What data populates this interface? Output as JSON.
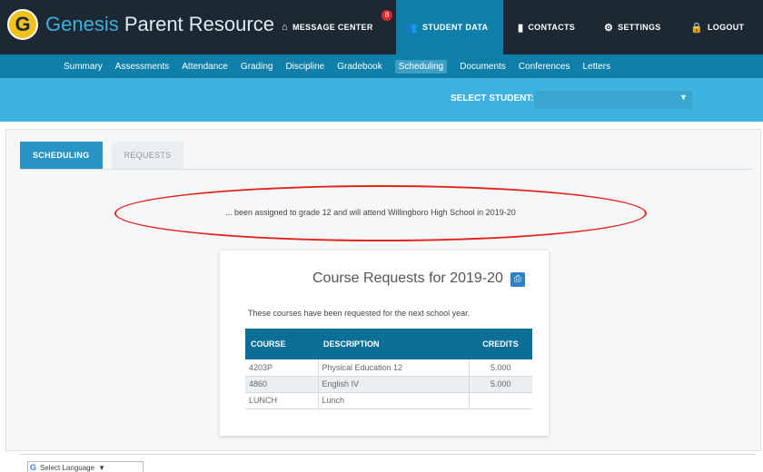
{
  "app": {
    "logo_letter": "G",
    "brand_part1": "Genesis",
    "brand_part2": "Parent Resource"
  },
  "topnav": {
    "message_center": "MESSAGE CENTER",
    "message_badge": "8",
    "student_data": "STUDENT DATA",
    "contacts": "CONTACTS",
    "settings": "SETTINGS",
    "logout": "LOGOUT"
  },
  "subnav": [
    "Summary",
    "Assessments",
    "Attendance",
    "Grading",
    "Discipline",
    "Gradebook",
    "Scheduling",
    "Documents",
    "Conferences",
    "Letters"
  ],
  "subnav_active": "Scheduling",
  "select_student": {
    "label": "SELECT STUDENT:"
  },
  "tabs": {
    "active": "SCHEDULING",
    "inactive": "REQUESTS"
  },
  "notice": "... been assigned to grade 12 and will attend Willingboro High School in 2019-20",
  "card": {
    "title": "Course Requests for 2019-20",
    "subtitle": "These courses have been requested for the next school year.",
    "columns": [
      "COURSE",
      "DESCRIPTION",
      "CREDITS"
    ],
    "rows": [
      [
        "4203P",
        "Physical Education 12",
        "5.000"
      ],
      [
        "4860",
        "English IV",
        "5.000"
      ],
      [
        "LUNCH",
        "Lunch",
        ""
      ]
    ]
  },
  "translate": {
    "label": "Select Language",
    "arrow": "▼"
  },
  "colors": {
    "topbar": "#1e2834",
    "subnav": "#0d7fa8",
    "select_band": "#3eb3df",
    "annotation": "#e2231a"
  }
}
